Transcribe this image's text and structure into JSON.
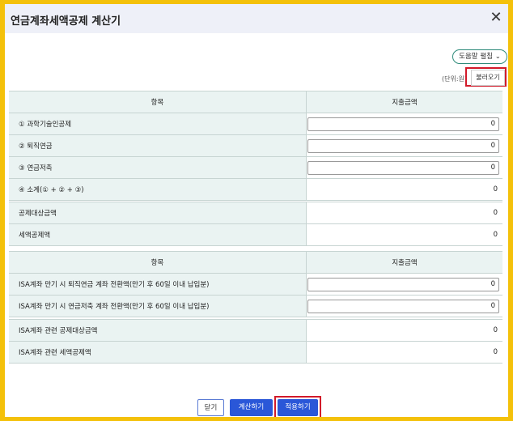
{
  "dialog": {
    "title": "연금계좌세액공제 계산기",
    "close_glyph": "✕"
  },
  "toolbar": {
    "help_label": "도움말 펼침",
    "help_chevron": "⌄",
    "unit_label": "(단위:원)",
    "load_label": "불러오기"
  },
  "table1": {
    "header_item": "항목",
    "header_amount": "지출금액",
    "rows": [
      {
        "label": "① 과학기술인공제",
        "value": "0",
        "type": "input"
      },
      {
        "label": "② 퇴직연금",
        "value": "0",
        "type": "input"
      },
      {
        "label": "③ 연금저축",
        "value": "0",
        "type": "input"
      },
      {
        "label": "④ 소계(① + ② + ③)",
        "value": "0",
        "type": "static"
      }
    ]
  },
  "summary1": {
    "rows": [
      {
        "label": "공제대상금액",
        "value": "0"
      },
      {
        "label": "세액공제액",
        "value": "0"
      }
    ]
  },
  "table2": {
    "header_item": "항목",
    "header_amount": "지출금액",
    "rows": [
      {
        "label": "ISA계좌 만기 시 퇴직연금 계좌 전환액(만기 후 60일 이내 납입분)",
        "value": "0",
        "type": "input"
      },
      {
        "label": "ISA계좌 만기 시 연금저축 계좌 전환액(만기 후 60일 이내 납입분)",
        "value": "0",
        "type": "input"
      }
    ]
  },
  "summary2": {
    "rows": [
      {
        "label": "ISA계좌 관련 공제대상금액",
        "value": "0"
      },
      {
        "label": "ISA계좌 관련 세액공제액",
        "value": "0"
      }
    ]
  },
  "buttons": {
    "close_label": "닫기",
    "calc_label": "계산하기",
    "apply_label": "적용하기"
  }
}
